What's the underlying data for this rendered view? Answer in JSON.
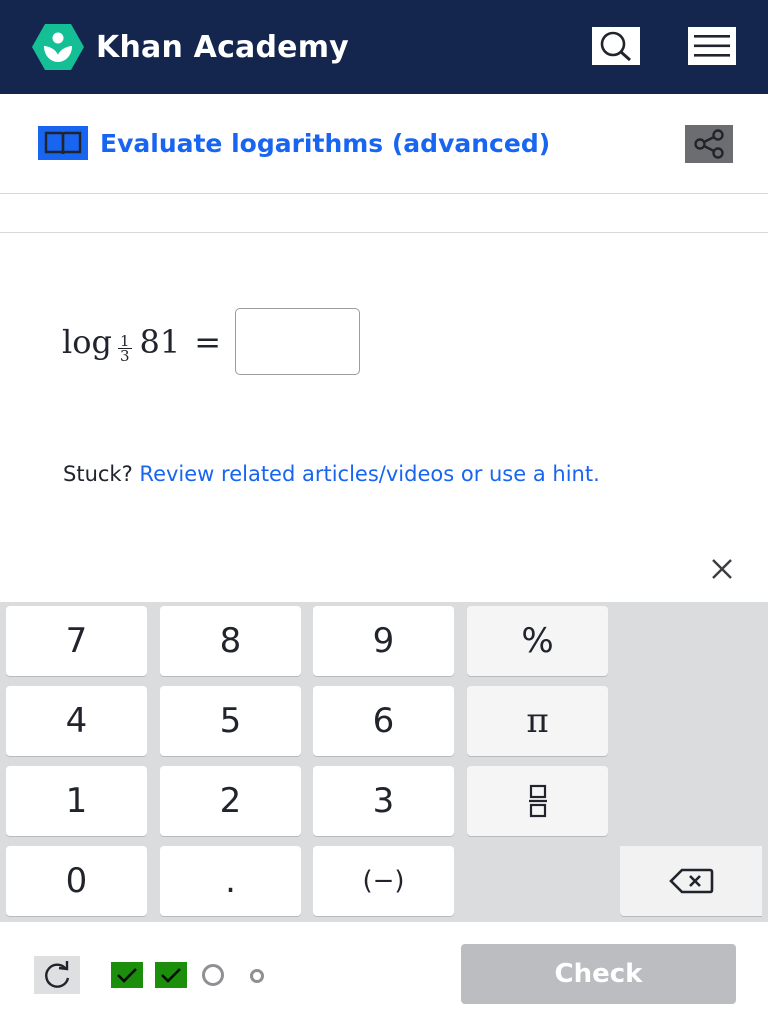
{
  "header": {
    "brand": "Khan Academy",
    "icons": [
      "khan-logo-icon",
      "search-icon",
      "hamburger-menu-icon"
    ],
    "colors": {
      "background": "#14254e",
      "logo": "#14bf96"
    }
  },
  "exercise": {
    "title": "Evaluate logarithms (advanced)",
    "title_icon": "book-icon",
    "share_icon": "share-icon"
  },
  "problem": {
    "log_word": "log",
    "base_numerator": "1",
    "base_denominator": "3",
    "argument": "81",
    "equals": "="
  },
  "help": {
    "stuck_label": "Stuck?",
    "link_text": "Review related articles/videos or use a hint."
  },
  "keypad": {
    "keys": [
      "7",
      "8",
      "9",
      "%",
      "4",
      "5",
      "6",
      "π",
      "1",
      "2",
      "3",
      "0",
      ".",
      "(−)"
    ],
    "fraction_key_icon": "fraction-icon",
    "backspace_icon": "backspace-icon",
    "close_icon": "close-icon"
  },
  "footer": {
    "check_label": "Check",
    "restart_icon": "restart-icon",
    "progress": [
      "correct",
      "correct",
      "current",
      "pending"
    ],
    "colors": {
      "correct": "#1b8f0c",
      "accent": "#1865f2"
    }
  }
}
